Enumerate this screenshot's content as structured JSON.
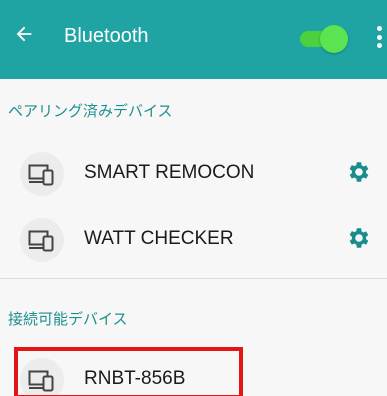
{
  "header": {
    "title": "Bluetooth",
    "bluetooth_enabled": true,
    "back_icon": "arrow-left-icon",
    "menu_icon": "more-vert-icon"
  },
  "paired": {
    "heading": "ペアリング済みデバイス",
    "devices": [
      {
        "name": "SMART REMOCON",
        "icon": "device-icon",
        "settings_icon": "gear-icon"
      },
      {
        "name": "WATT CHECKER",
        "icon": "device-icon",
        "settings_icon": "gear-icon"
      }
    ]
  },
  "available": {
    "heading": "接続可能デバイス",
    "devices": [
      {
        "name": "RNBT-856B",
        "icon": "device-icon",
        "highlighted": true
      }
    ]
  },
  "colors": {
    "appbar": "#20a3a3",
    "toggle_on": "#4bd03f",
    "section_header": "#1d8f8f",
    "gear": "#1a8c8c",
    "highlight": "#e41515",
    "background": "#f7f7f7"
  }
}
